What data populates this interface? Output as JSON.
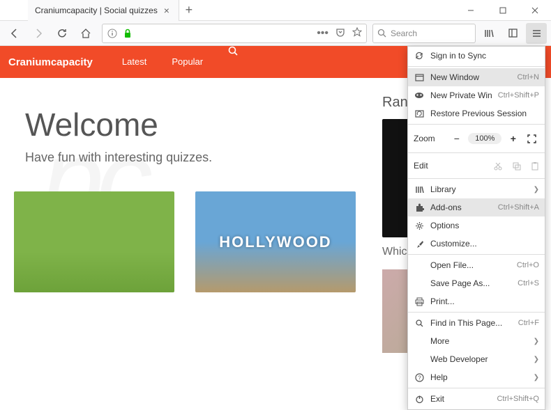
{
  "window": {
    "tab_title": "Craniumcapacity | Social quizzes"
  },
  "toolbar": {
    "search_placeholder": "Search"
  },
  "site": {
    "brand": "Craniumcapacity",
    "nav": {
      "latest": "Latest",
      "popular": "Popular"
    },
    "hero_title": "Welcome",
    "hero_sub": "Have fun with interesting quizzes.",
    "side_heading": "Rando",
    "side_question": "Which ... life?",
    "thumb2_text": "HOLLYWOOD"
  },
  "menu": {
    "sign_in": "Sign in to Sync",
    "new_window": {
      "label": "New Window",
      "shortcut": "Ctrl+N"
    },
    "new_private": {
      "label": "New Private Window",
      "shortcut": "Ctrl+Shift+P"
    },
    "restore": "Restore Previous Session",
    "zoom_label": "Zoom",
    "zoom_pct": "100%",
    "edit_label": "Edit",
    "library": "Library",
    "addons": {
      "label": "Add-ons",
      "shortcut": "Ctrl+Shift+A"
    },
    "options": "Options",
    "customize": "Customize...",
    "open_file": {
      "label": "Open File...",
      "shortcut": "Ctrl+O"
    },
    "save_as": {
      "label": "Save Page As...",
      "shortcut": "Ctrl+S"
    },
    "print": "Print...",
    "find": {
      "label": "Find in This Page...",
      "shortcut": "Ctrl+F"
    },
    "more": "More",
    "webdev": "Web Developer",
    "help": "Help",
    "exit": {
      "label": "Exit",
      "shortcut": "Ctrl+Shift+Q"
    }
  }
}
